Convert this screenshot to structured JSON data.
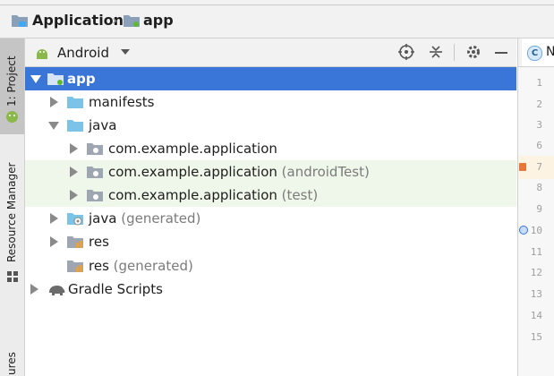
{
  "breadcrumb": {
    "project": "Application",
    "module": "app"
  },
  "toolstrip": {
    "project_tab": "1: Project",
    "resource_tab": "Resource Manager",
    "bottom_tab": "ures"
  },
  "panel": {
    "view_mode": "Android"
  },
  "tree": [
    {
      "label": "app",
      "suffix": ""
    },
    {
      "label": "manifests",
      "suffix": ""
    },
    {
      "label": "java",
      "suffix": ""
    },
    {
      "label": "com.example.application",
      "suffix": ""
    },
    {
      "label": "com.example.application",
      "suffix": "(androidTest)"
    },
    {
      "label": "com.example.application",
      "suffix": "(test)"
    },
    {
      "label": "java",
      "suffix": "(generated)"
    },
    {
      "label": "res",
      "suffix": ""
    },
    {
      "label": "res",
      "suffix": "(generated)"
    },
    {
      "label": "Gradle Scripts",
      "suffix": ""
    }
  ],
  "editor": {
    "tab_label": "N",
    "line_numbers": [
      "1",
      "2",
      "3",
      "6",
      "7",
      "8",
      "9",
      "10",
      "11",
      "12",
      "13",
      "14",
      "15"
    ]
  },
  "colors": {
    "selection": "#3a75d8",
    "test_row": "#eef7e9",
    "folder": "#7cc3e8"
  }
}
